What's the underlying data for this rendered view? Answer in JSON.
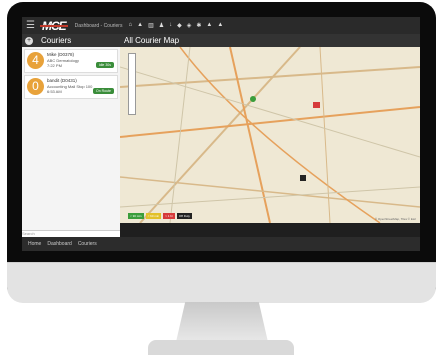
{
  "app": {
    "logo": "MCE",
    "top_breadcrumb": "Dashboard - Couriers"
  },
  "left_panel": {
    "title": "Couriers",
    "couriers": [
      {
        "count": "4",
        "name": "Mike (D0378)",
        "company": "ABC Dermatology",
        "time": "7:22 PM",
        "status": "Idle 30s"
      },
      {
        "count": "0",
        "name": "bandit (D0431)",
        "company": "Accounting Mail Stop 100",
        "time": "6:53 AM",
        "status": "On Route"
      }
    ],
    "search_placeholder": "Search"
  },
  "map": {
    "title": "All Courier Map",
    "legend": [
      {
        "label": "< 30 min",
        "color": "#3a9d3a"
      },
      {
        "label": "< 60 min",
        "color": "#e2c12a"
      },
      {
        "label": "> 1 hr",
        "color": "#d63a3a"
      },
      {
        "label": "Off Duty",
        "color": "#222222"
      }
    ],
    "attribution": "© OpenStreetMap, Tiles © Esri"
  },
  "breadcrumbs": [
    "Home",
    "Dashboard",
    "Couriers"
  ]
}
